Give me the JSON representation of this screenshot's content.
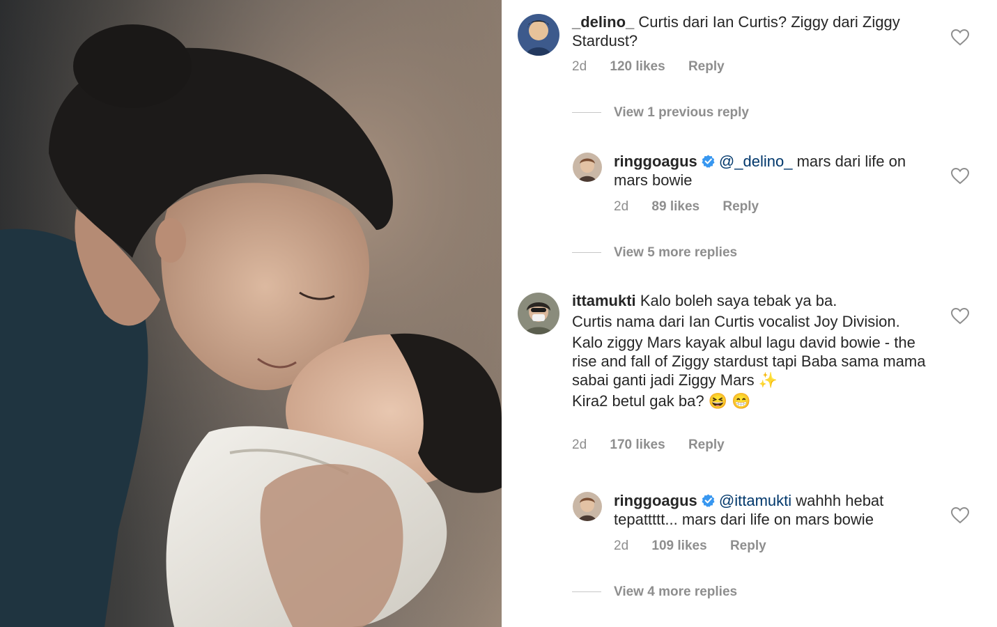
{
  "comments": [
    {
      "username": "_delino_",
      "text": "Curtis dari Ian Curtis? Ziggy dari Ziggy Stardust?",
      "time": "2d",
      "likes": "120 likes",
      "reply": "Reply",
      "view_replies": "View 1 previous reply",
      "replies": [
        {
          "username": "ringgoagus",
          "mention": "@_delino_",
          "text": "mars dari life on mars bowie",
          "time": "2d",
          "likes": "89 likes",
          "reply": "Reply"
        }
      ],
      "more_replies": "View 5 more replies"
    },
    {
      "username": "ittamukti",
      "text_lines": [
        "Kalo boleh saya tebak ya ba.",
        "Curtis nama dari Ian Curtis vocalist Joy Division.",
        "Kalo ziggy Mars kayak albul lagu david bowie - the rise and fall of Ziggy stardust tapi Baba sama mama sabai ganti jadi Ziggy Mars ✨",
        "Kira2 betul gak ba? 😆 😁"
      ],
      "time": "2d",
      "likes": "170 likes",
      "reply": "Reply",
      "replies": [
        {
          "username": "ringgoagus",
          "mention": "@ittamukti",
          "text": "wahhh hebat tepattttt... mars dari life on mars bowie",
          "time": "2d",
          "likes": "109 likes",
          "reply": "Reply"
        }
      ],
      "more_replies": "View 4 more replies"
    }
  ],
  "colors": {
    "text": "#262626",
    "secondary": "#8e8e8e",
    "mention": "#00376b",
    "verified": "#3897f0"
  },
  "icons": [
    "heart-icon",
    "verified-badge-icon"
  ]
}
